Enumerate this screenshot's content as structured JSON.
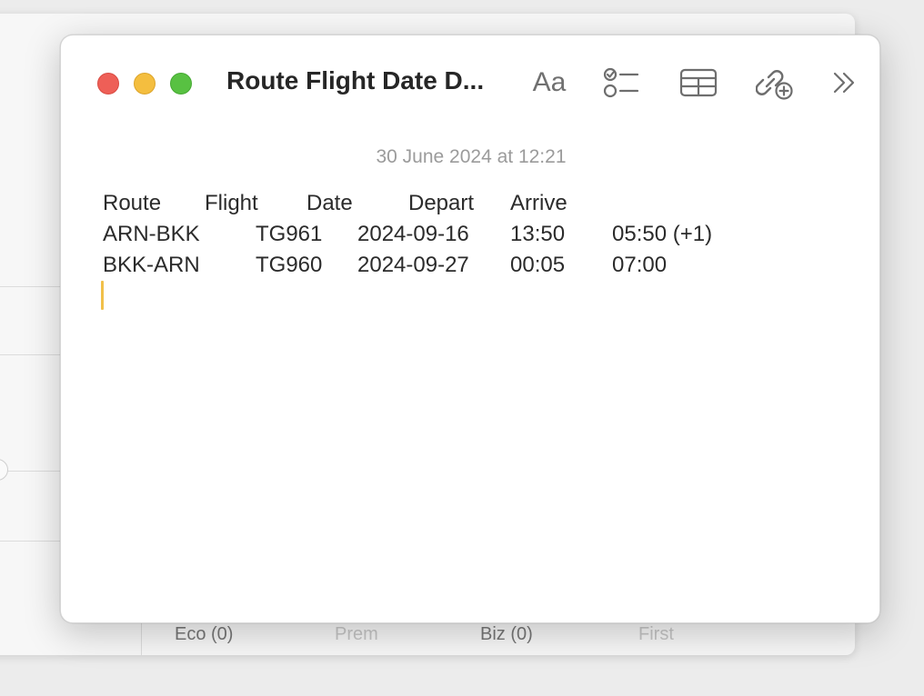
{
  "background_window": {
    "tabs": [
      "Eco (0)",
      "Prem",
      "Biz (0)",
      "First"
    ]
  },
  "note": {
    "title": "Route Flight Date D...",
    "format_label": "Aa",
    "date_stamp": "30 June 2024 at 12:21",
    "rows": [
      [
        "Route",
        "Flight",
        "Date",
        "Depart",
        "Arrive",
        ""
      ],
      [
        "ARN-BKK",
        "TG961",
        "2024-09-16",
        "13:50",
        "05:50 (+1)",
        ""
      ],
      [
        "BKK-ARN",
        "TG960",
        "2024-09-27",
        "00:05",
        "07:00",
        ""
      ]
    ]
  },
  "icons": {
    "checklist": "checklist-icon",
    "table": "table-icon",
    "link": "link-add-icon",
    "more": "chevron-double-right-icon"
  },
  "colors": {
    "close": "#ee5f57",
    "minimize": "#f4be3f",
    "maximize": "#58c142",
    "caret": "#f1c04a"
  }
}
